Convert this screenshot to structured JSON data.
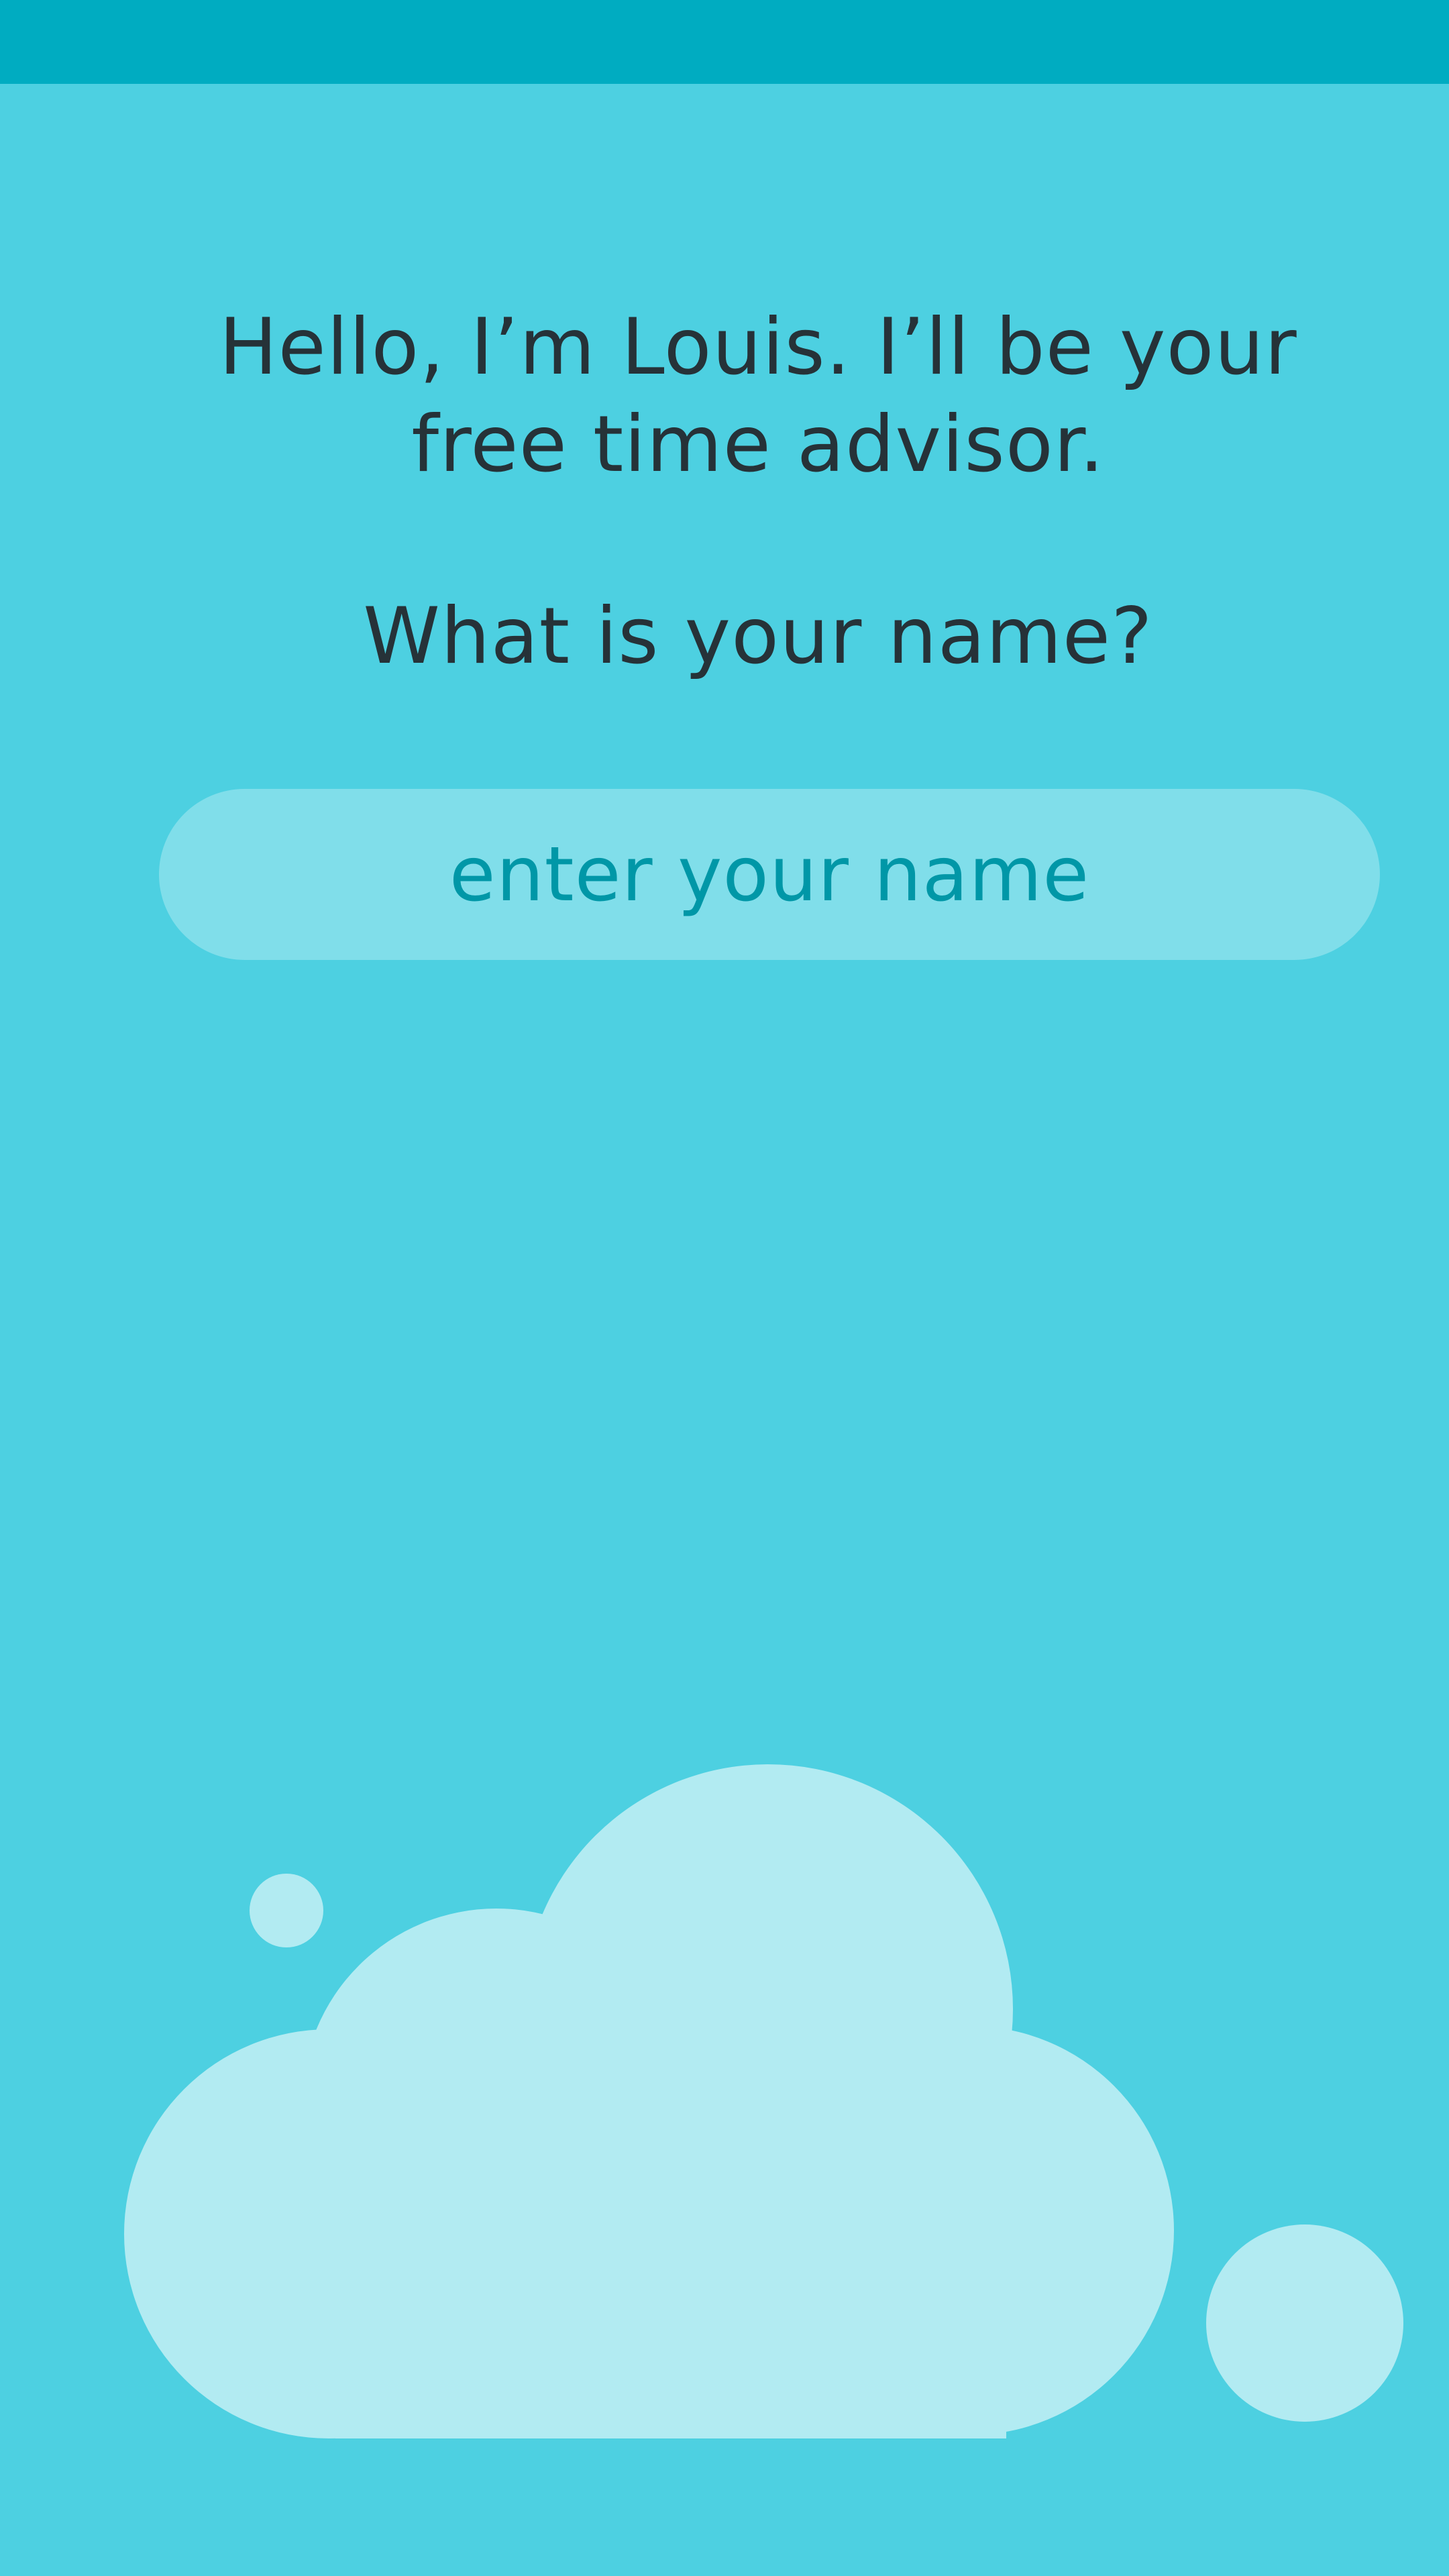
{
  "prompt": {
    "greeting": "Hello, I’m Louis. I’ll be your free time advisor.",
    "question": "What is your name?"
  },
  "name_field": {
    "placeholder": "enter your name",
    "value": ""
  },
  "colors": {
    "background": "#4dd0e1",
    "status_bar": "#00acc1",
    "input_background": "#80deea",
    "placeholder_text": "#0097a7",
    "body_text": "#263238",
    "cloud": "#b2ebf2"
  },
  "decorations": {
    "cloud": "cloud-illustration",
    "bubbles": [
      "small-bubble",
      "large-bubble"
    ]
  }
}
